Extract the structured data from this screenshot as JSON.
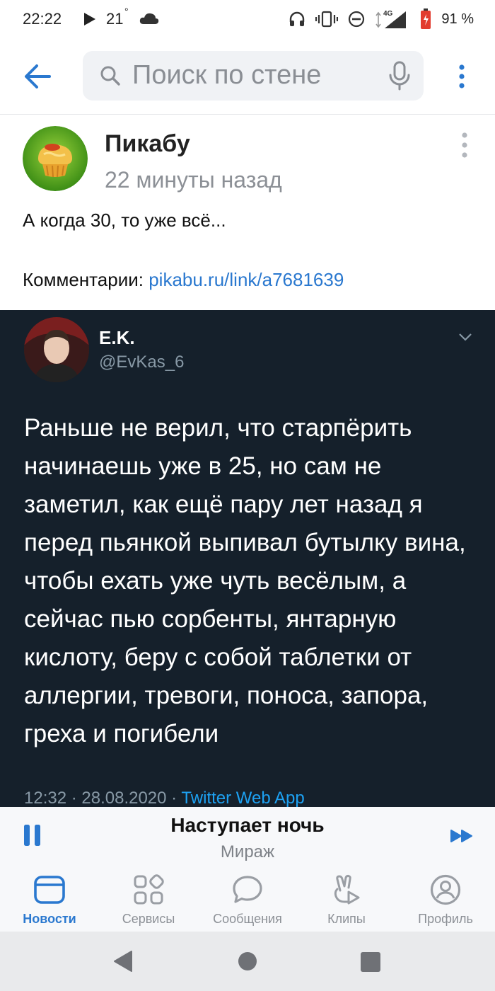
{
  "status_bar": {
    "time": "22:22",
    "temperature": "21",
    "degree_symbol": "°",
    "network": "4G",
    "battery": "91 %"
  },
  "search": {
    "placeholder": "Поиск по стене"
  },
  "post": {
    "author": "Пикабу",
    "time": "22 минуты назад",
    "text": "А когда 30, то уже всё...",
    "comments_label": "Комментарии: ",
    "comments_link": "pikabu.ru/link/a7681639"
  },
  "tweet": {
    "name": "E.K.",
    "handle": "@EvKas_6",
    "text": "Раньше не верил, что старпёрить начинаешь уже в 25, но сам не заметил, как ещё пару лет назад я перед пьянкой выпивал бутылку вина, чтобы ехать уже чуть весёлым, а сейчас пью сорбенты, янтарную кислоту, беру с собой таблетки от аллергии, тревоги, поноса, запора, греха и погибели",
    "meta": "12:32 · 28.08.2020 · ",
    "source": "Twitter Web App"
  },
  "player": {
    "title": "Наступает ночь",
    "artist": "Мираж"
  },
  "nav": {
    "items": [
      {
        "label": "Новости",
        "icon": "news-icon",
        "active": true
      },
      {
        "label": "Сервисы",
        "icon": "services-icon",
        "active": false
      },
      {
        "label": "Сообщения",
        "icon": "messages-icon",
        "active": false
      },
      {
        "label": "Клипы",
        "icon": "clips-icon",
        "active": false
      },
      {
        "label": "Профиль",
        "icon": "profile-icon",
        "active": false
      }
    ]
  },
  "colors": {
    "accent": "#2a78cf",
    "tweet_bg": "#15202b",
    "tweet_secondary": "#8899a6"
  }
}
